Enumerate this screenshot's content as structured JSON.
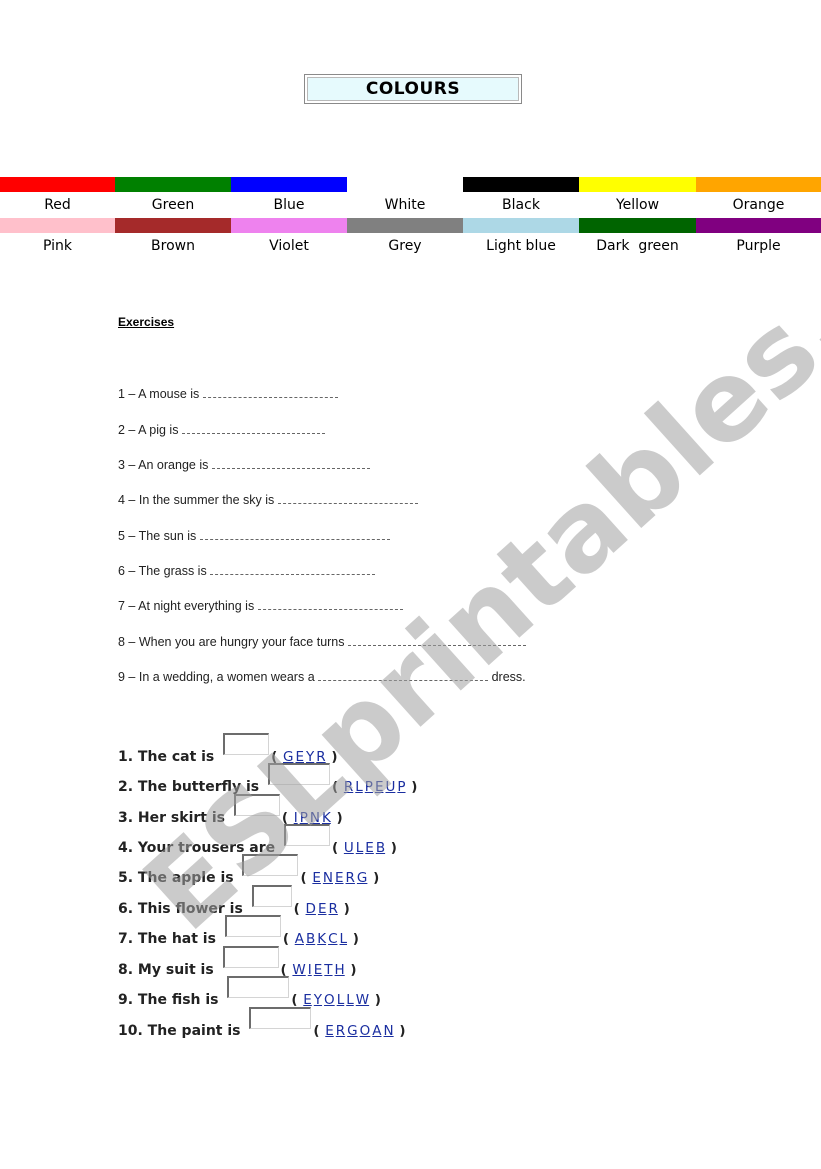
{
  "title": "COLOURS",
  "colour_rows": [
    [
      {
        "name": "Red",
        "color": "#ff0000"
      },
      {
        "name": "Green",
        "color": "#008000"
      },
      {
        "name": "Blue",
        "color": "#0000ff"
      },
      {
        "name": "White",
        "color": "#ffffff"
      },
      {
        "name": "Black",
        "color": "#000000"
      },
      {
        "name": "Yellow",
        "color": "#ffff00"
      },
      {
        "name": "Orange",
        "color": "#ffa500"
      }
    ],
    [
      {
        "name": "Pink",
        "color": "#ffc0cb"
      },
      {
        "name": "Brown",
        "color": "#a52a2a"
      },
      {
        "name": "Violet",
        "color": "#ee82ee"
      },
      {
        "name": "Grey",
        "color": "#808080"
      },
      {
        "name": "Light blue",
        "color": "#add8e6"
      },
      {
        "name": "Dark  green",
        "color": "#006400"
      },
      {
        "name": "Purple",
        "color": "#800080"
      }
    ]
  ],
  "exercises": {
    "heading": "Exercises",
    "fill_in": [
      {
        "prompt": "1 – A mouse is ",
        "after": ""
      },
      {
        "prompt": "2 – A pig is ",
        "after": ""
      },
      {
        "prompt": "3 – An orange is ",
        "after": ""
      },
      {
        "prompt": "4 – In the summer the sky is ",
        "after": ""
      },
      {
        "prompt": "5 – The sun is ",
        "after": ""
      },
      {
        "prompt": "6 – The grass is ",
        "after": ""
      },
      {
        "prompt": "7 – At night everything is ",
        "after": ""
      },
      {
        "prompt": "8 – When you are hungry your face turns ",
        "after": ""
      },
      {
        "prompt": "9 – In a wedding, a women wears a ",
        "after": " dress."
      }
    ],
    "scrambled": [
      {
        "prompt": "1. The cat is",
        "letters": [
          "G",
          "E",
          "Y",
          "R"
        ],
        "answer": ""
      },
      {
        "prompt": "2. The butterfly is",
        "letters": [
          "R",
          "L",
          "P",
          "E",
          "U",
          "P"
        ],
        "answer": ""
      },
      {
        "prompt": "3. Her skirt is",
        "letters": [
          "I",
          "P",
          "N",
          "K"
        ],
        "answer": ""
      },
      {
        "prompt": "4. Your trousers are",
        "letters": [
          "U",
          "L",
          "E",
          "B"
        ],
        "answer": ""
      },
      {
        "prompt": "5. The apple is",
        "letters": [
          "E",
          "N",
          "E",
          "R",
          "G"
        ],
        "answer": ""
      },
      {
        "prompt": "6. This flower is",
        "letters": [
          "D",
          "E",
          "R"
        ],
        "answer": ""
      },
      {
        "prompt": "7. The hat is",
        "letters": [
          "A",
          "B",
          "K",
          "C",
          "L"
        ],
        "answer": ""
      },
      {
        "prompt": "8. My suit is",
        "letters": [
          "W",
          "I",
          "E",
          "T",
          "H"
        ],
        "answer": ""
      },
      {
        "prompt": "9. The fish is",
        "letters": [
          "E",
          "Y",
          "O",
          "L",
          "L",
          "W"
        ],
        "answer": ""
      },
      {
        "prompt": "10. The paint is",
        "letters": [
          "E",
          "R",
          "G",
          "O",
          "A",
          "N"
        ],
        "answer": ""
      }
    ]
  },
  "watermark": "ESLprintables.com",
  "open_paren": "( ",
  "close_paren": " )"
}
